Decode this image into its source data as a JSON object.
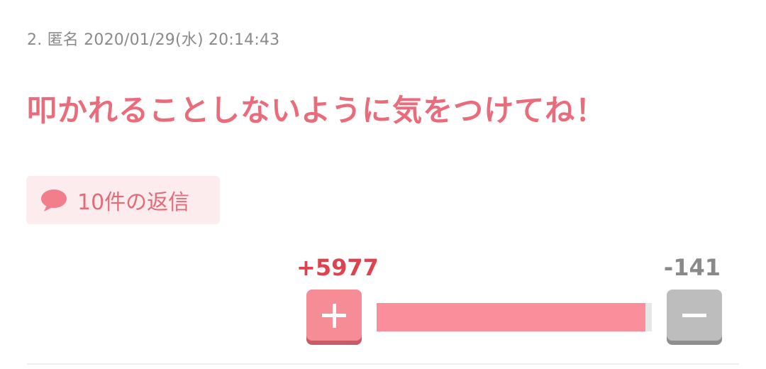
{
  "comment": {
    "meta": "2. 匿名 2020/01/29(水) 20:14:43",
    "body": "叩かれることしないように気をつけてね！",
    "reply_label": "10件の返信",
    "reply_icon": "speech-bubble-icon",
    "votes": {
      "plus_label": "+5977",
      "minus_label": "-141",
      "plus": 5977,
      "minus": 141
    }
  },
  "colors": {
    "body_text": "#ea6b7a",
    "plus": "#e0414f",
    "plus_button": "#f58c96",
    "bar_fill": "#fa8f9b",
    "minus_button": "#bdbdbd",
    "reply_bg": "#fdeced"
  }
}
